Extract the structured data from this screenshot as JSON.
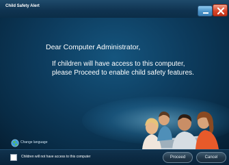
{
  "window": {
    "title": "Child Safety Alert"
  },
  "message": {
    "greeting": "Dear Computer Administrator,",
    "line1": "If children will have access to this computer,",
    "line2": "please Proceed to enable child safety features."
  },
  "language": {
    "label": "Change language",
    "icon": "globe-icon"
  },
  "footer": {
    "checkbox_label": "Children will not have access to this computer",
    "checkbox_checked": false,
    "proceed_label": "Proceed",
    "cancel_label": "Cancel"
  },
  "colors": {
    "background": "#0d3c5e",
    "close_button": "#d9472b",
    "minimize_button": "#4b93c8"
  }
}
